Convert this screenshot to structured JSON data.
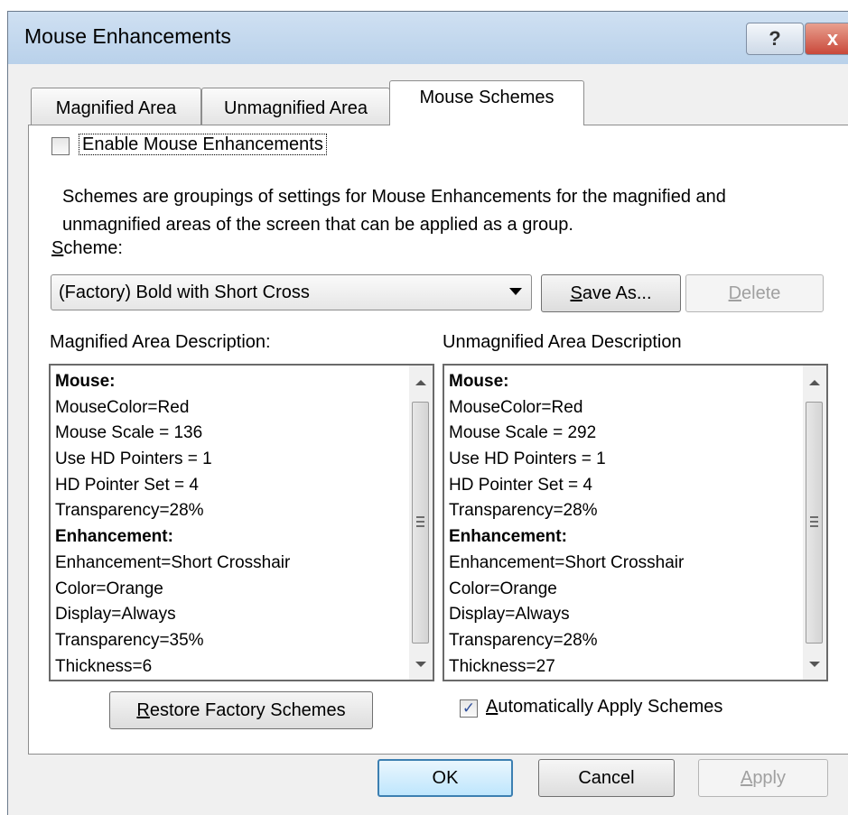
{
  "window": {
    "title": "Mouse Enhancements",
    "help_glyph": "?",
    "close_glyph": "x"
  },
  "tabs": [
    {
      "label": "Magnified Area",
      "active": false
    },
    {
      "label": "Unmagnified Area",
      "active": false
    },
    {
      "label": "Mouse Schemes",
      "active": true
    }
  ],
  "enable_checkbox": {
    "label": "Enable Mouse Enhancements",
    "checked": false
  },
  "description": "Schemes are groupings of settings for Mouse Enhancements for the magnified and unmagnified areas of the screen that can be applied as a group.",
  "scheme": {
    "label_access_key": "S",
    "label_rest": "cheme:",
    "selected": "(Factory) Bold with Short Cross"
  },
  "buttons": {
    "save_as_key": "S",
    "save_as_rest": "ave As...",
    "delete_key": "D",
    "delete_rest": "elete",
    "restore_key": "R",
    "restore_rest": "estore Factory Schemes",
    "ok": "OK",
    "cancel": "Cancel",
    "apply_key": "A",
    "apply_rest": "pply"
  },
  "magnified": {
    "heading": "Magnified Area Description:",
    "lines": [
      {
        "text": "Mouse:",
        "bold": true
      },
      {
        "text": "MouseColor=Red"
      },
      {
        "text": "Mouse Scale = 136"
      },
      {
        "text": "Use HD Pointers = 1"
      },
      {
        "text": "HD Pointer Set = 4"
      },
      {
        "text": "Transparency=28%"
      },
      {
        "text": "Enhancement:",
        "bold": true
      },
      {
        "text": "Enhancement=Short Crosshair"
      },
      {
        "text": "Color=Orange"
      },
      {
        "text": "Display=Always"
      },
      {
        "text": "Transparency=35%"
      },
      {
        "text": "Thickness=6"
      }
    ]
  },
  "unmagnified": {
    "heading": "Unmagnified Area Description",
    "lines": [
      {
        "text": "Mouse:",
        "bold": true
      },
      {
        "text": "MouseColor=Red"
      },
      {
        "text": "Mouse Scale = 292"
      },
      {
        "text": "Use HD Pointers = 1"
      },
      {
        "text": "HD Pointer Set = 4"
      },
      {
        "text": "Transparency=28%"
      },
      {
        "text": "Enhancement:",
        "bold": true
      },
      {
        "text": "Enhancement=Short Crosshair"
      },
      {
        "text": "Color=Orange"
      },
      {
        "text": "Display=Always"
      },
      {
        "text": "Transparency=28%"
      },
      {
        "text": "Thickness=27"
      }
    ]
  },
  "auto_apply": {
    "label_access_key": "A",
    "label_rest": "utomatically Apply Schemes",
    "checked": true,
    "check_glyph": "✓"
  },
  "colors": {
    "title_bar": "#b9d1ea",
    "close_button": "#c9483a",
    "default_button_border": "#3c7fb1",
    "panel_bg": "#ffffff",
    "dialog_bg": "#f0f0f0"
  },
  "icons": [
    "help-icon",
    "close-icon",
    "dropdown-arrow-icon",
    "scroll-up-icon",
    "scroll-down-icon",
    "scroll-grip-icon",
    "checkmark-icon"
  ]
}
